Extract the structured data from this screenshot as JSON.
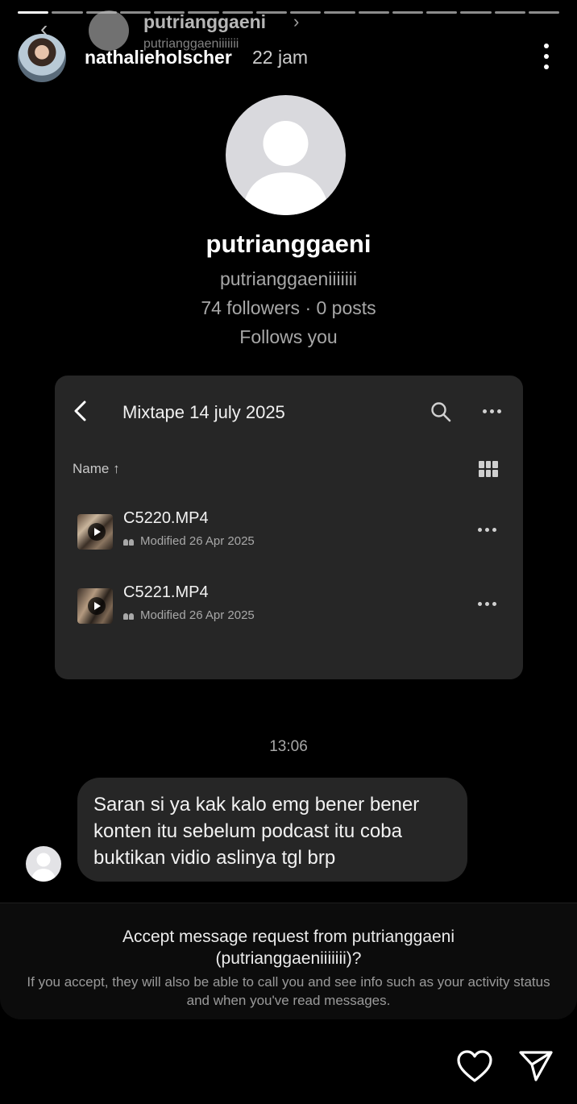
{
  "story": {
    "progress_segments": 16,
    "progress_done": 1,
    "username": "nathalieholscher",
    "time_ago": "22 jam",
    "more_icon": "more-vertical-icon"
  },
  "dm_header": {
    "back_icon": "chevron-left-icon",
    "name": "putrianggaeni",
    "chevron": "›",
    "handle": "putrianggaeniiiiiii"
  },
  "profile": {
    "name": "putrianggaeni",
    "handle": "putrianggaeniiiiiii",
    "stats": "74 followers · 0 posts",
    "follows_you": "Follows you"
  },
  "drive": {
    "title": "Mixtape 14 july 2025",
    "sort_label": "Name ↑",
    "files": [
      {
        "name": "C5220.MP4",
        "modified": "Modified 26 Apr 2025"
      },
      {
        "name": "C5221.MP4",
        "modified": "Modified 26 Apr 2025"
      }
    ]
  },
  "chat": {
    "timestamp": "13:06",
    "message": "Saran si ya kak kalo emg bener bener konten itu sebelum podcast itu coba buktikan vidio aslinya tgl brp"
  },
  "request": {
    "title": "Accept message request from putrianggaeni (putrianggaeniiiiiii)?",
    "description": "If you accept, they will also be able to call you and see info such as your activity status and when you've read messages."
  },
  "actions": {
    "like_icon": "heart-icon",
    "share_icon": "send-icon"
  }
}
